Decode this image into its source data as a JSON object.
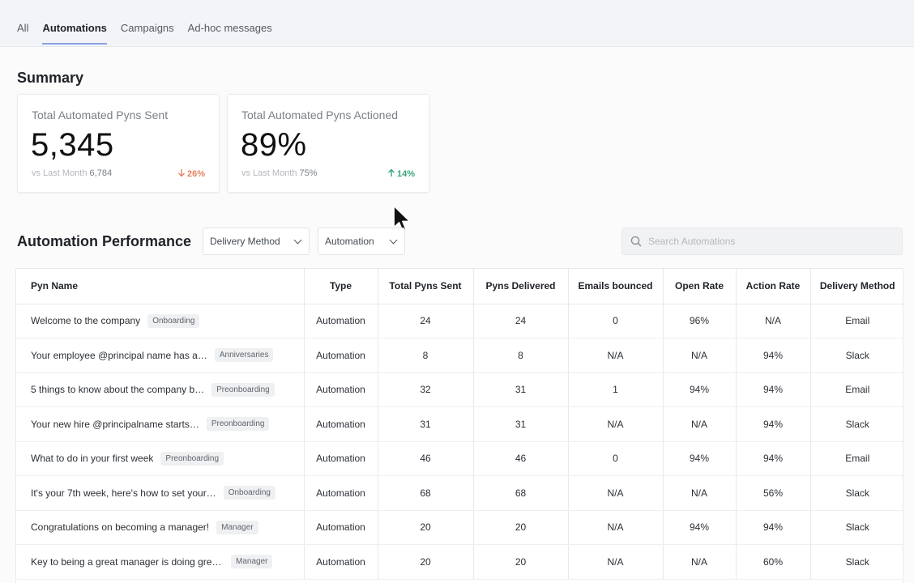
{
  "tabs": [
    "All",
    "Automations",
    "Campaigns",
    "Ad-hoc messages"
  ],
  "active_tab": "Automations",
  "summary": {
    "title": "Summary",
    "cards": [
      {
        "label": "Total Automated Pyns Sent",
        "value": "5,345",
        "compare_label": "vs Last Month",
        "compare_value": "6,784",
        "delta": "26%",
        "direction": "down"
      },
      {
        "label": "Total Automated Pyns Actioned",
        "value": "89%",
        "compare_label": "vs Last Month",
        "compare_value": "75%",
        "delta": "14%",
        "direction": "up"
      }
    ]
  },
  "performance": {
    "title": "Automation Performance",
    "filters": {
      "delivery_method": "Delivery Method",
      "automation": "Automation"
    },
    "search_placeholder": "Search Automations"
  },
  "table": {
    "columns": [
      "Pyn Name",
      "Type",
      "Total Pyns Sent",
      "Pyns Delivered",
      "Emails bounced",
      "Open Rate",
      "Action Rate",
      "Delivery Method"
    ],
    "rows": [
      {
        "name": "Welcome to the company",
        "tag": "Onboarding",
        "type": "Automation",
        "sent": "24",
        "delivered": "24",
        "bounced": "0",
        "open": "96%",
        "action": "N/A",
        "method": "Email"
      },
      {
        "name": "Your employee @principal name has a…",
        "tag": "Anniversaries",
        "type": "Automation",
        "sent": "8",
        "delivered": "8",
        "bounced": "N/A",
        "open": "N/A",
        "action": "94%",
        "method": "Slack"
      },
      {
        "name": "5 things to know about the company b…",
        "tag": "Preonboarding",
        "type": "Automation",
        "sent": "32",
        "delivered": "31",
        "bounced": "1",
        "open": "94%",
        "action": "94%",
        "method": "Email"
      },
      {
        "name": "Your new hire @principalname starts…",
        "tag": "Preonboarding",
        "type": "Automation",
        "sent": "31",
        "delivered": "31",
        "bounced": "N/A",
        "open": "N/A",
        "action": "94%",
        "method": "Slack"
      },
      {
        "name": "What to do in your first week",
        "tag": "Preonboarding",
        "type": "Automation",
        "sent": "46",
        "delivered": "46",
        "bounced": "0",
        "open": "94%",
        "action": "94%",
        "method": "Email"
      },
      {
        "name": "It's your 7th week, here's how to set your…",
        "tag": "Onboarding",
        "type": "Automation",
        "sent": "68",
        "delivered": "68",
        "bounced": "N/A",
        "open": "N/A",
        "action": "56%",
        "method": "Slack"
      },
      {
        "name": "Congratulations on becoming a manager!",
        "tag": "Manager",
        "type": "Automation",
        "sent": "20",
        "delivered": "20",
        "bounced": "N/A",
        "open": "94%",
        "action": "94%",
        "method": "Slack"
      },
      {
        "name": "Key to being a great manager is doing grea…",
        "tag": "Manager",
        "type": "Automation",
        "sent": "20",
        "delivered": "20",
        "bounced": "N/A",
        "open": "N/A",
        "action": "60%",
        "method": "Slack"
      }
    ]
  },
  "colors": {
    "accent": "#8aa0e6",
    "down": "#e8815f",
    "up": "#3aa37a"
  },
  "icons": {
    "search": "search-icon",
    "down": "arrow-down-icon",
    "up": "arrow-up-icon",
    "cursor": "mouse-pointer-icon"
  }
}
